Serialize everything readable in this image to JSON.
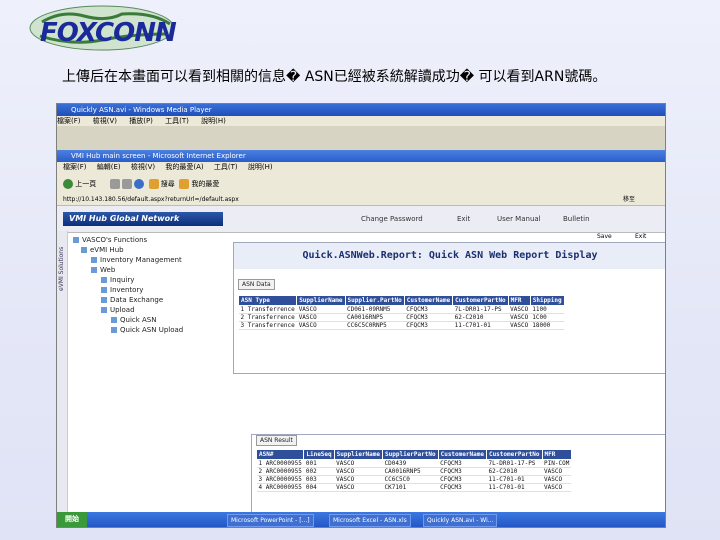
{
  "logo": {
    "text": "FOXCONN"
  },
  "caption": "上傳后在本畫面可以看到相關的信息� ASN已經被系統解讀成功� 可以看到ARN號碼。",
  "media_player": {
    "title": "Quickly ASN.avi - Windows Media Player",
    "menu": [
      "檔案(F)",
      "檢視(V)",
      "播放(P)",
      "工具(T)",
      "說明(H)"
    ]
  },
  "browser": {
    "title": "VMI Hub main screen - Microsoft Internet Explorer",
    "menu": [
      "檔案(F)",
      "編輯(E)",
      "檢視(V)",
      "我的最愛(A)",
      "工具(T)",
      "說明(H)"
    ],
    "back_label": "上一頁",
    "search_label": "搜尋",
    "favorites_label": "我的最愛",
    "address": "http://10.143.180.56/default.aspx?returnUrl=/default.aspx",
    "go_label": "移至"
  },
  "vmi": {
    "brand": "VMI Hub Global Network",
    "links": [
      "Change Password",
      "Exit",
      "User Manual",
      "Bulletin"
    ],
    "side_label": "eVMI Solutions",
    "tree": {
      "root": "VASCO's Functions",
      "items": [
        "eVMI Hub",
        "Inventory Management",
        "Web",
        "Inquiry",
        "Inventory",
        "Data Exchange",
        "Upload",
        "Quick ASN",
        "Quick ASN Upload"
      ]
    },
    "save": "Save",
    "exit": "Exit"
  },
  "report": {
    "title": "Quick.ASNWeb.Report: Quick ASN Web Report Display",
    "tab": "ASN Data",
    "columns": [
      "ASN Type",
      "SupplierName",
      "Supplier.PartNo",
      "CustomerName",
      "CustomerPartNo",
      "MFR",
      "Shipping"
    ],
    "rows": [
      [
        "1 Transferrence",
        "VASCO",
        "CD061-09RNM5",
        "CFQCM3",
        "7L-DR01-17-PS",
        "VASCO",
        "1100"
      ],
      [
        "2 Transferrence",
        "VASCO",
        "CA0016RNP5",
        "CFQCM3",
        "62-C2010",
        "VASCO",
        "1C00"
      ],
      [
        "3 Transferrence",
        "VASCO",
        "CC6C5C0RNP5",
        "CFQCM3",
        "11-C701-01",
        "VASCO",
        "18000"
      ]
    ]
  },
  "detail": {
    "tab": "ASN Result",
    "columns": [
      "ASN#",
      "LineSeq",
      "SupplierName",
      "SupplierPartNo",
      "CustomerName",
      "CustomerPartNo",
      "MFR"
    ],
    "rows": [
      [
        "1 ARC0000955",
        "001",
        "VASCO",
        "CD0439",
        "CFQCM3",
        "7L-DR01-17-PS",
        "PIN-COM"
      ],
      [
        "2 ARC0000955",
        "002",
        "VASCO",
        "CA0016RNP5",
        "CFQCM3",
        "62-C2010",
        "VASCO"
      ],
      [
        "3 ARC0000955",
        "003",
        "VASCO",
        "CC6C5C0",
        "CFQCM3",
        "11-C701-01",
        "VASCO"
      ],
      [
        "4 ARC0000955",
        "004",
        "VASCO",
        "CK7101",
        "CFQCM3",
        "11-C701-01",
        "VASCO"
      ]
    ]
  },
  "taskbar": {
    "start": "開始",
    "items": [
      "Microsoft PowerPoint - [...]",
      "Microsoft Excel - ASN.xls",
      "Quickly ASN.avi - Wi..."
    ]
  },
  "colors": {
    "brand_blue": "#1a2a9a",
    "header_blue": "#2f4f9a"
  }
}
